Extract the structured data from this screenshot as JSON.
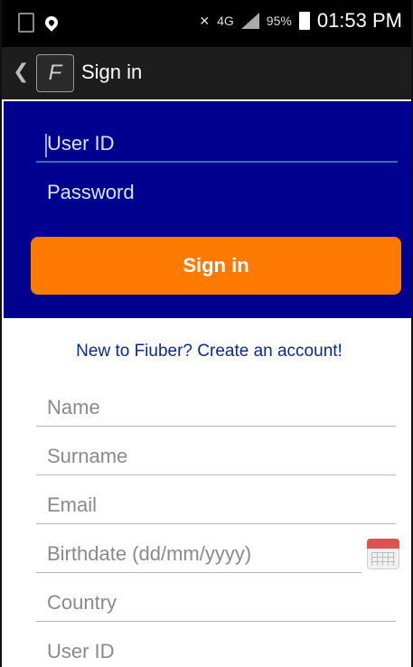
{
  "status_bar": {
    "icons": [
      "notification-icon",
      "location-icon",
      "mute-icon",
      "signal-icon",
      "battery-icon"
    ],
    "network": "4G",
    "battery": "95%",
    "time": "01:53 PM"
  },
  "action_bar": {
    "back_icon": "chevron-left-icon",
    "app_icon_glyph": "F",
    "title": "Sign in"
  },
  "login": {
    "user_id_placeholder": "User ID",
    "password_placeholder": "Password",
    "signin_label": "Sign in",
    "bg_color": "#00008f",
    "button_color": "#ff7a00"
  },
  "register": {
    "title": "New to Fiuber? Create an account!",
    "name_placeholder": "Name",
    "surname_placeholder": "Surname",
    "email_placeholder": "Email",
    "birthdate_placeholder": "Birthdate (dd/mm/yyyy)",
    "country_placeholder": "Country",
    "user_id_placeholder": "User ID",
    "calendar_icon": "calendar-icon"
  }
}
